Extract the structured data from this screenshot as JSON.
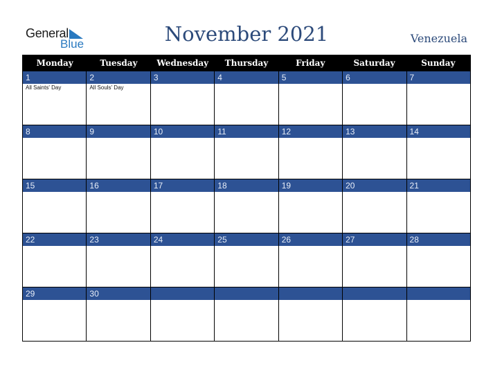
{
  "logo": {
    "line1": "General",
    "line2": "Blue"
  },
  "title": "November 2021",
  "country": "Venezuela",
  "colors": {
    "header_bg": "#000000",
    "band_bg": "#2d5294",
    "title": "#2c4a7a",
    "logo_blue": "#2a7ac0"
  },
  "weekdays": [
    "Monday",
    "Tuesday",
    "Wednesday",
    "Thursday",
    "Friday",
    "Saturday",
    "Sunday"
  ],
  "weeks": [
    [
      {
        "day": "1",
        "holiday": "All Saints' Day"
      },
      {
        "day": "2",
        "holiday": "All Souls' Day"
      },
      {
        "day": "3",
        "holiday": ""
      },
      {
        "day": "4",
        "holiday": ""
      },
      {
        "day": "5",
        "holiday": ""
      },
      {
        "day": "6",
        "holiday": ""
      },
      {
        "day": "7",
        "holiday": ""
      }
    ],
    [
      {
        "day": "8",
        "holiday": ""
      },
      {
        "day": "9",
        "holiday": ""
      },
      {
        "day": "10",
        "holiday": ""
      },
      {
        "day": "11",
        "holiday": ""
      },
      {
        "day": "12",
        "holiday": ""
      },
      {
        "day": "13",
        "holiday": ""
      },
      {
        "day": "14",
        "holiday": ""
      }
    ],
    [
      {
        "day": "15",
        "holiday": ""
      },
      {
        "day": "16",
        "holiday": ""
      },
      {
        "day": "17",
        "holiday": ""
      },
      {
        "day": "18",
        "holiday": ""
      },
      {
        "day": "19",
        "holiday": ""
      },
      {
        "day": "20",
        "holiday": ""
      },
      {
        "day": "21",
        "holiday": ""
      }
    ],
    [
      {
        "day": "22",
        "holiday": ""
      },
      {
        "day": "23",
        "holiday": ""
      },
      {
        "day": "24",
        "holiday": ""
      },
      {
        "day": "25",
        "holiday": ""
      },
      {
        "day": "26",
        "holiday": ""
      },
      {
        "day": "27",
        "holiday": ""
      },
      {
        "day": "28",
        "holiday": ""
      }
    ],
    [
      {
        "day": "29",
        "holiday": ""
      },
      {
        "day": "30",
        "holiday": ""
      },
      {
        "day": "",
        "holiday": ""
      },
      {
        "day": "",
        "holiday": ""
      },
      {
        "day": "",
        "holiday": ""
      },
      {
        "day": "",
        "holiday": ""
      },
      {
        "day": "",
        "holiday": ""
      }
    ]
  ]
}
